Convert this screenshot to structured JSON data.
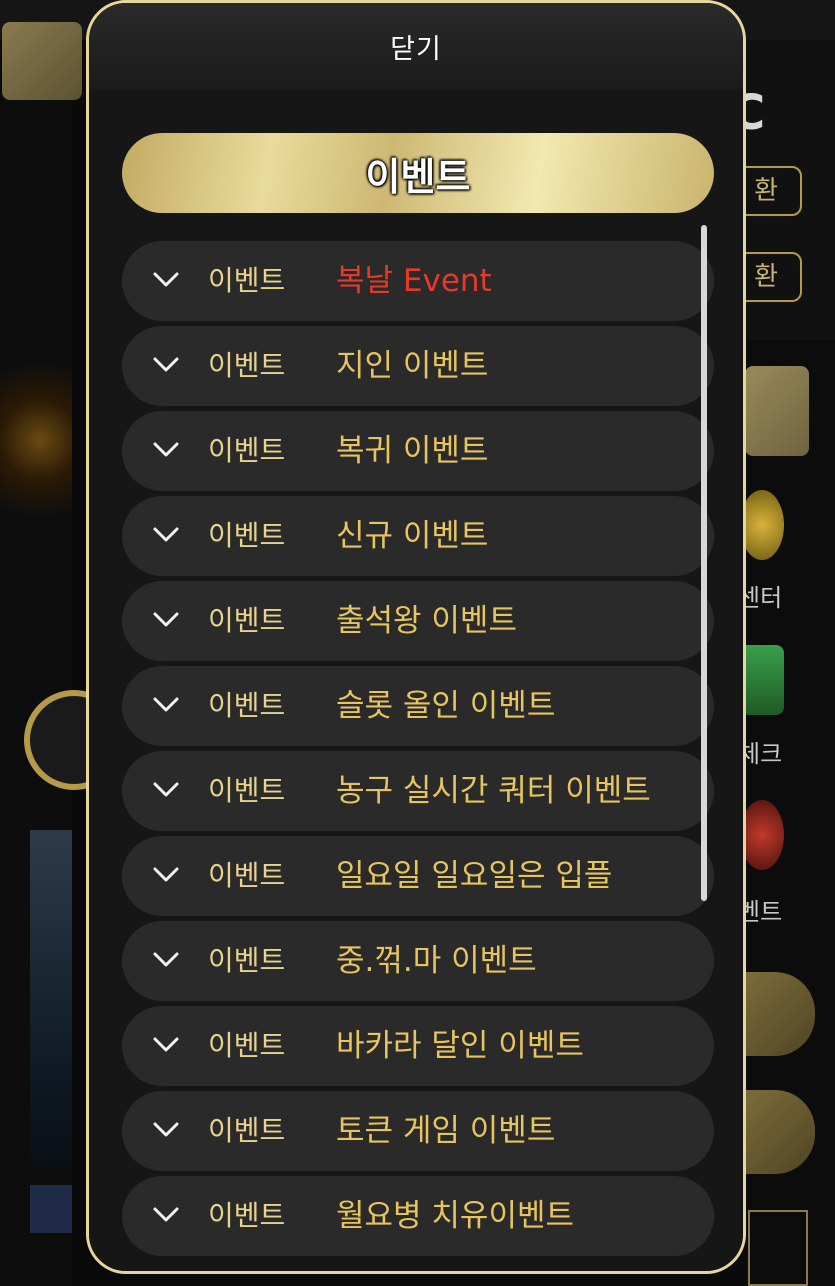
{
  "modal": {
    "close_label": "닫기",
    "title": "이벤트"
  },
  "colors": {
    "accent_gold": "#e8d79a",
    "highlight_red": "#e53a2a",
    "title_gold": "#e6c45f",
    "category_gold": "#e7d28f"
  },
  "events": [
    {
      "category": "이벤트",
      "title": "복날 Event",
      "highlight": true
    },
    {
      "category": "이벤트",
      "title": "지인 이벤트"
    },
    {
      "category": "이벤트",
      "title": "복귀 이벤트"
    },
    {
      "category": "이벤트",
      "title": "신규 이벤트"
    },
    {
      "category": "이벤트",
      "title": "출석왕 이벤트"
    },
    {
      "category": "이벤트",
      "title": "슬롯 올인 이벤트"
    },
    {
      "category": "이벤트",
      "title": "농구 실시간 쿼터 이벤트"
    },
    {
      "category": "이벤트",
      "title": "일요일 일요일은 입플"
    },
    {
      "category": "이벤트",
      "title": "중.꺾.마 이벤트"
    },
    {
      "category": "이벤트",
      "title": "바카라 달인 이벤트"
    },
    {
      "category": "이벤트",
      "title": "토큰 게임 이벤트"
    },
    {
      "category": "이벤트",
      "title": "월요병 치유이벤트"
    }
  ],
  "background": {
    "right_letter": "C",
    "right_pill_1": "환",
    "right_pill_2": "환",
    "right_label_1": "센터",
    "right_label_2": "체크",
    "right_label_3": "벤트"
  }
}
